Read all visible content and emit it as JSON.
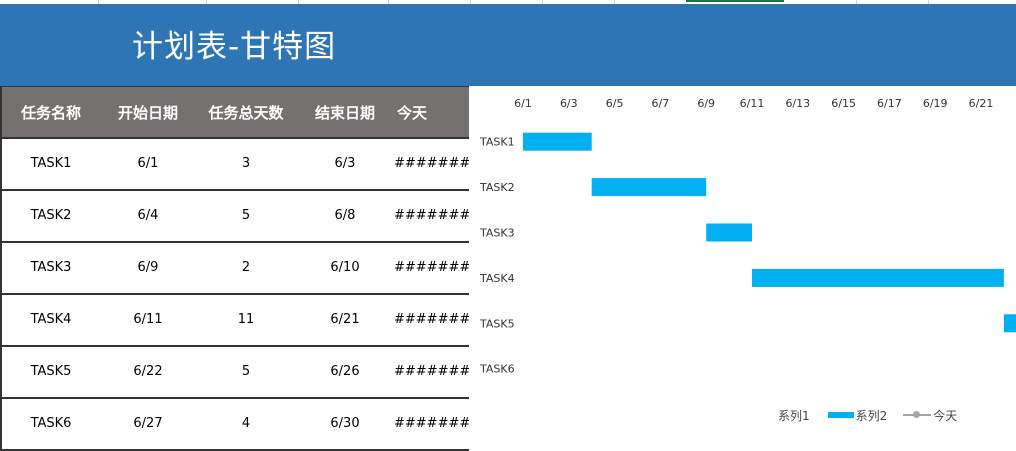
{
  "title": "计划表-甘特图",
  "table": {
    "headers": [
      "任务名称",
      "开始日期",
      "任务总天数",
      "结束日期",
      "今天"
    ],
    "rows": [
      {
        "name": "TASK1",
        "start": "6/1",
        "days": "3",
        "end": "6/3",
        "today": "#########"
      },
      {
        "name": "TASK2",
        "start": "6/4",
        "days": "5",
        "end": "6/8",
        "today": "#########"
      },
      {
        "name": "TASK3",
        "start": "6/9",
        "days": "2",
        "end": "6/10",
        "today": "#########"
      },
      {
        "name": "TASK4",
        "start": "6/11",
        "days": "11",
        "end": "6/21",
        "today": "#########"
      },
      {
        "name": "TASK5",
        "start": "6/22",
        "days": "5",
        "end": "6/26",
        "today": "#########"
      },
      {
        "name": "TASK6",
        "start": "6/27",
        "days": "4",
        "end": "6/30",
        "today": "#########"
      }
    ]
  },
  "chart_data": {
    "type": "bar",
    "orientation": "horizontal-stacked",
    "x_tick_labels": [
      "6/1",
      "6/3",
      "6/5",
      "6/7",
      "6/9",
      "6/11",
      "6/13",
      "6/15",
      "6/17",
      "6/19",
      "6/21"
    ],
    "xlim": [
      "6/1",
      "6/24"
    ],
    "categories": [
      "TASK1",
      "TASK2",
      "TASK3",
      "TASK4",
      "TASK5",
      "TASK6"
    ],
    "series": [
      {
        "name": "系列1",
        "start": [
          "6/1",
          "6/4",
          "6/9",
          "6/11",
          "6/22",
          "6/27"
        ],
        "visible": false
      },
      {
        "name": "系列2",
        "duration_days": [
          3,
          5,
          2,
          11,
          5,
          4
        ],
        "color": "#00b0f0"
      },
      {
        "name": "今天",
        "style": "line-marker",
        "color": "#a5a5a5"
      }
    ],
    "legend": {
      "position": "bottom-right",
      "entries": [
        "系列1",
        "系列2",
        "今天"
      ]
    },
    "grid": false
  },
  "colors": {
    "header_bg": "#2e75b6",
    "table_header_bg": "#767171",
    "bar": "#00b0f0"
  }
}
